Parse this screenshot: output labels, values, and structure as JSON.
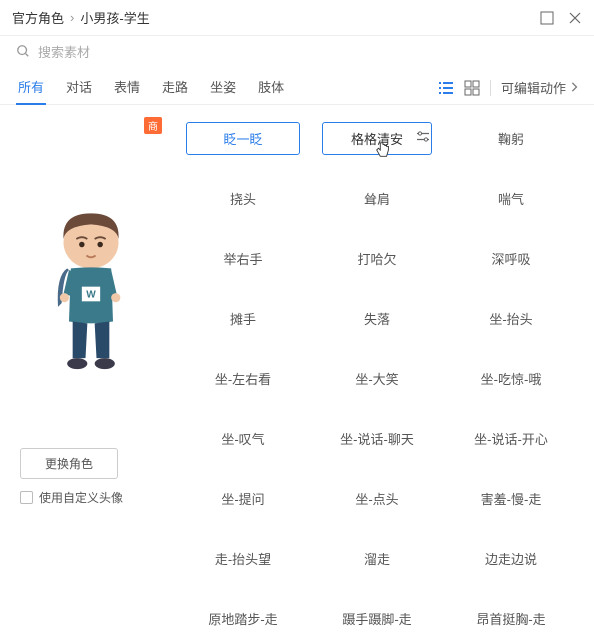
{
  "breadcrumb": {
    "root": "官方角色",
    "current": "小男孩-学生"
  },
  "search": {
    "placeholder": "搜索素材"
  },
  "tabs": [
    "所有",
    "对话",
    "表情",
    "走路",
    "坐姿",
    "肢体"
  ],
  "activeTab": 0,
  "editableActions": "可编辑动作",
  "badge": "商",
  "changeRole": "更换角色",
  "useCustomAvatar": "使用自定义头像",
  "items": [
    "眨一眨",
    "格格清安",
    "鞠躬",
    "挠头",
    "耸肩",
    "喘气",
    "举右手",
    "打哈欠",
    "深呼吸",
    "摊手",
    "失落",
    "坐-抬头",
    "坐-左右看",
    "坐-大笑",
    "坐-吃惊-哦",
    "坐-叹气",
    "坐-说话-聊天",
    "坐-说话-开心",
    "坐-提问",
    "坐-点头",
    "害羞-慢-走",
    "走-抬头望",
    "溜走",
    "边走边说",
    "原地踏步-走",
    "蹑手蹑脚-走",
    "昂首挺胸-走"
  ],
  "selectedIndex": 0,
  "hoverIndex": 1
}
